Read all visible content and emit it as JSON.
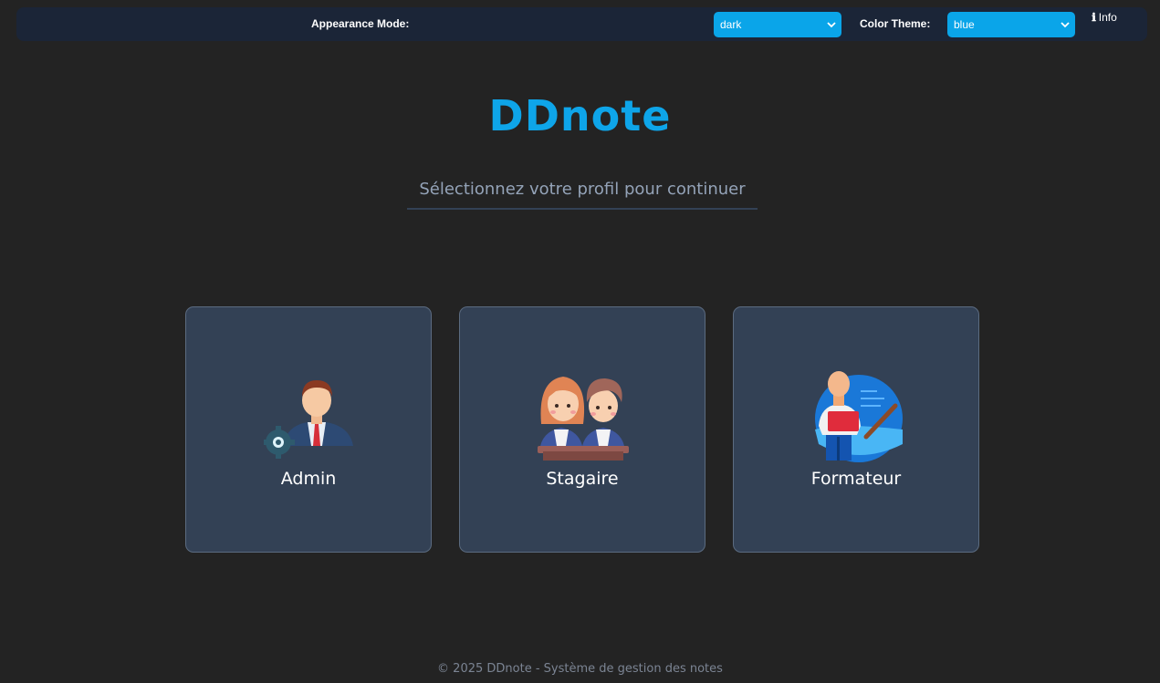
{
  "topbar": {
    "appearance_label": "Appearance Mode:",
    "appearance_value": "dark",
    "theme_label": "Color Theme:",
    "theme_value": "blue",
    "info_label": "Info"
  },
  "header": {
    "title": "DDnote",
    "subtitle": "Sélectionnez votre profil pour continuer"
  },
  "profiles": [
    {
      "label": "Admin",
      "icon": "admin-icon"
    },
    {
      "label": "Stagaire",
      "icon": "students-icon"
    },
    {
      "label": "Formateur",
      "icon": "teacher-icon"
    }
  ],
  "footer": {
    "text": "© 2025 DDnote - Système de gestion des notes"
  },
  "colors": {
    "accent": "#0ea5e9",
    "background": "#232323",
    "card": "#334155",
    "topbar": "#1b2537"
  }
}
